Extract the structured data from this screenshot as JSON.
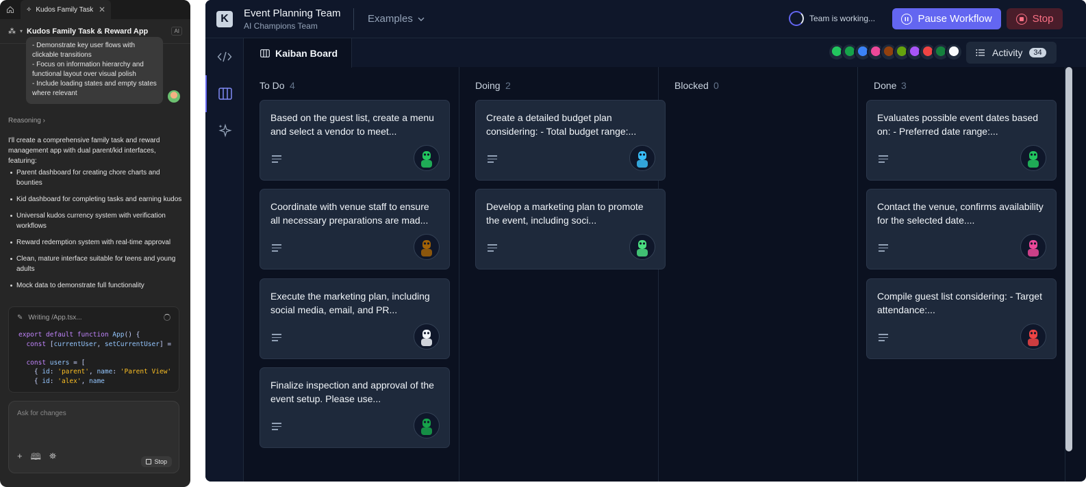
{
  "assistant": {
    "tab_title": "Kudos Family Task & Reward App",
    "project_title": "Kudos Family Task & Reward App",
    "ai_badge": "AI",
    "user_message_lines": [
      "- Demonstrate key user flows with clickable transitions",
      "- Focus on information hierarchy and functional layout over visual polish",
      "- Include loading states and empty states where relevant"
    ],
    "reasoning_label": "Reasoning",
    "response_intro": "I'll create a comprehensive family task and reward management app with dual parent/kid interfaces, featuring:",
    "features": [
      "Parent dashboard for creating chore charts and bounties",
      "Kid dashboard for completing tasks and earning kudos",
      "Universal kudos currency system with verification workflows",
      "Reward redemption system with real-time approval",
      "Clean, mature interface suitable for teens and young adults",
      "Mock data to demonstrate full functionality"
    ],
    "code_status": "Writing /App.tsx...",
    "ask_placeholder": "Ask for changes",
    "stop_label": "Stop"
  },
  "app": {
    "team_name": "Event Planning Team",
    "team_subtitle": "AI Champions Team",
    "examples_label": "Examples",
    "status_text": "Team is working...",
    "pause_label": "Pause Workflow",
    "stop_label": "Stop",
    "board_tab": "Kaiban Board",
    "activity_label": "Activity",
    "activity_count": "34",
    "columns": [
      {
        "name": "To Do",
        "count": "4",
        "cards": [
          {
            "text": "Based on the guest list, create a menu and select a vendor to meet...",
            "agent": "green"
          },
          {
            "text": "Coordinate with venue staff to ensure all necessary preparations are mad...",
            "agent": "brown"
          },
          {
            "text": "Execute the marketing plan, including social media, email, and PR...",
            "agent": "white"
          },
          {
            "text": "Finalize inspection and approval of the event setup. Please use...",
            "agent": "green2"
          }
        ]
      },
      {
        "name": "Doing",
        "count": "2",
        "cards": [
          {
            "text": "Create a detailed budget plan considering: - Total budget range:...",
            "agent": "blue"
          },
          {
            "text": "Develop a marketing plan to promote the event, including soci...",
            "agent": "green3"
          }
        ]
      },
      {
        "name": "Blocked",
        "count": "0",
        "cards": []
      },
      {
        "name": "Done",
        "count": "3",
        "cards": [
          {
            "text": "Evaluates possible event dates based on: - Preferred date range:...",
            "agent": "green"
          },
          {
            "text": "Contact the venue, confirms availability for the selected date....",
            "agent": "pink"
          },
          {
            "text": "Compile guest list considering: - Target attendance:...",
            "agent": "red"
          }
        ]
      }
    ],
    "header_agent_colors": [
      "#22c55e",
      "#16a34a",
      "#3b82f6",
      "#ec4899",
      "#92400e",
      "#65a30d",
      "#a855f7",
      "#ef4444",
      "#15803d",
      "#f8fafc"
    ],
    "accent_color": "#6366f1"
  }
}
